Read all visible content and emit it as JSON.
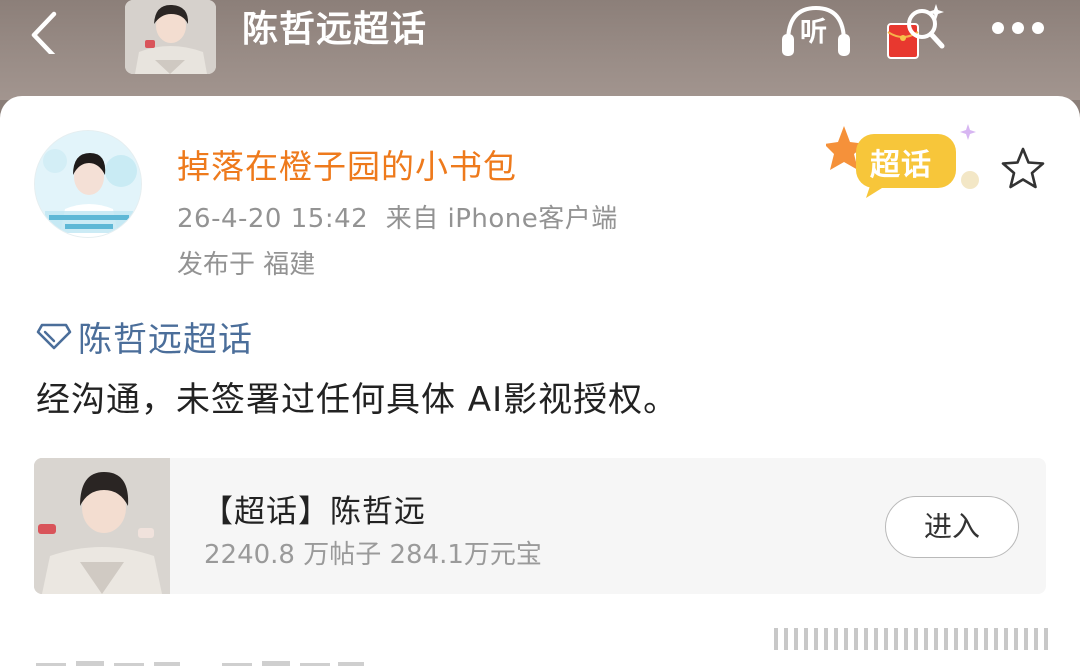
{
  "header": {
    "title": "陈哲远超话",
    "listen_label": "听",
    "icons": {
      "back": "chevron-left-icon",
      "listen": "headphones-icon",
      "redpack": "red-envelope-search-icon",
      "more": "more-dots-icon"
    }
  },
  "post": {
    "author": "掉落在橙子园的小书包",
    "timestamp": "26-4-20 15:42",
    "source_prefix": "来自",
    "source_client": "iPhone客户端",
    "location": "发布于 福建",
    "badge_label": "超话",
    "topic_label": "陈哲远超话",
    "body": "经沟通，未签署过任何具体 AI影视授权。"
  },
  "supertopic_card": {
    "title": "【超话】陈哲远",
    "stats": "2240.8 万帖子 284.1万元宝",
    "enter_label": "进入"
  },
  "colors": {
    "header_bg": "#8c7f79",
    "author": "#ee7a1c",
    "topic_link": "#4b6e9a",
    "meta": "#939393",
    "badge": "#f7c63a"
  }
}
